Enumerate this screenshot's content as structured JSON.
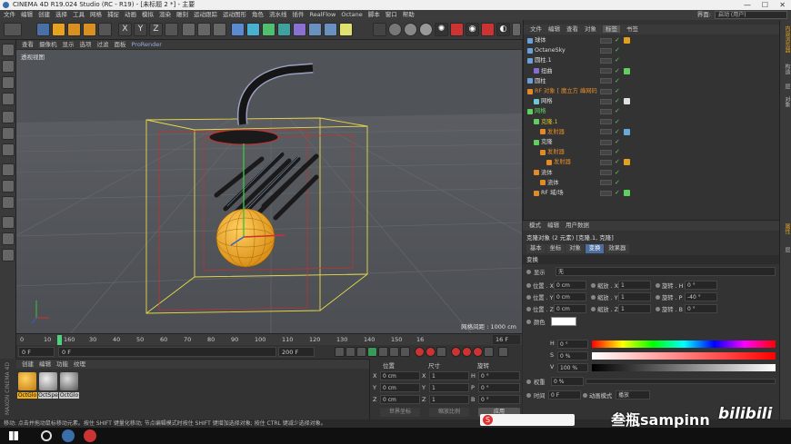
{
  "window": {
    "title": "CINEMA 4D R19.024 Studio (RC - R19) - [未标题 2 *] - 主要"
  },
  "menubar": {
    "items": [
      "文件",
      "编辑",
      "创建",
      "选择",
      "工具",
      "网格",
      "捕捉",
      "动画",
      "模拟",
      "渲染",
      "雕刻",
      "运动跟踪",
      "运动图形",
      "角色",
      "流水线",
      "插件",
      "RealFlow",
      "Octane",
      "脚本",
      "窗口",
      "帮助"
    ],
    "layout_label": "界面:",
    "layout_value": "启动 (用户)"
  },
  "viewport": {
    "menu": [
      "查看",
      "摄像机",
      "显示",
      "选项",
      "过滤",
      "面板",
      "ProRender"
    ],
    "label": "透视视图",
    "grid_spacing": "网格间距 : 1000 cm"
  },
  "timeline": {
    "ticks": [
      "0",
      "10",
      "160",
      "30",
      "40",
      "50",
      "60",
      "70",
      "80",
      "90",
      "100",
      "110",
      "120",
      "130",
      "140",
      "150",
      "16"
    ],
    "current_frame": "16 F",
    "start": "0 F",
    "start2": "0 F",
    "end": "200 F",
    "end2": "200 F"
  },
  "material_panel": {
    "menu": [
      "创建",
      "编辑",
      "功能",
      "纹理"
    ],
    "materials": [
      "OctGlo",
      "OctSpe",
      "OctGlo"
    ],
    "brand": "MAXON CINEMA 4D"
  },
  "coord_panel": {
    "headers": [
      "位置",
      "尺寸",
      "旋转"
    ],
    "rows": [
      {
        "axis": "X",
        "pos": "0 cm",
        "size_axis": "X",
        "size": "1",
        "rot_axis": "H",
        "rot": "0 °"
      },
      {
        "axis": "Y",
        "pos": "0 cm",
        "size_axis": "Y",
        "size": "1",
        "rot_axis": "P",
        "rot": "0 °"
      },
      {
        "axis": "Z",
        "pos": "0 cm",
        "size_axis": "Z",
        "size": "1",
        "rot_axis": "B",
        "rot": "0 °"
      }
    ],
    "mode1": "世界坐标",
    "mode2": "缩放比例",
    "apply": "应用"
  },
  "object_panel": {
    "menu": [
      "文件",
      "编辑",
      "查看",
      "对象",
      "标签",
      "书签"
    ],
    "active_menu": "标签",
    "objects": [
      {
        "name": "球体",
        "indent": 0,
        "color": "#dcdcdc",
        "icon": "#6a9fd8"
      },
      {
        "name": "OctaneSky",
        "indent": 0,
        "color": "#dcdcdc",
        "icon": "#6a9fd8"
      },
      {
        "name": "圆柱.1",
        "indent": 0,
        "color": "#dcdcdc",
        "icon": "#6a9fd8"
      },
      {
        "name": "扭曲",
        "indent": 1,
        "color": "#dcdcdc",
        "icon": "#8a6ad8"
      },
      {
        "name": "圆柱",
        "indent": 0,
        "color": "#dcdcdc",
        "icon": "#6a9fd8"
      },
      {
        "name": "RF 对象 [ 魔立方 峰网码",
        "indent": 0,
        "color": "#e08a2a",
        "icon": "#e08a2a"
      },
      {
        "name": "网格",
        "indent": 1,
        "color": "#dcdcdc",
        "icon": "#6ac8d8"
      },
      {
        "name": "网格",
        "indent": 0,
        "color": "#5fd05f",
        "icon": "#5fd05f"
      },
      {
        "name": "克隆.1",
        "indent": 1,
        "color": "#e0c030",
        "icon": "#5fd05f"
      },
      {
        "name": "发射器",
        "indent": 2,
        "color": "#e08a2a",
        "icon": "#e08a2a"
      },
      {
        "name": "克隆",
        "indent": 1,
        "color": "#dcdcdc",
        "icon": "#5fd05f"
      },
      {
        "name": "发射器",
        "indent": 2,
        "color": "#e08a2a",
        "icon": "#e08a2a"
      },
      {
        "name": "发射器",
        "indent": 3,
        "color": "#e08a2a",
        "icon": "#e08a2a"
      },
      {
        "name": "流体",
        "indent": 1,
        "color": "#dcdcdc",
        "icon": "#e08a2a"
      },
      {
        "name": "流体",
        "indent": 2,
        "color": "#dcdcdc",
        "icon": "#e08a2a"
      },
      {
        "name": "RF 域/场",
        "indent": 1,
        "color": "#dcdcdc",
        "icon": "#e08a2a"
      }
    ]
  },
  "attr_panel": {
    "menu": [
      "模式",
      "编辑",
      "用户数据"
    ],
    "title": "克隆对象 (2 元素) [克隆.1, 克隆]",
    "tabs": [
      "基本",
      "坐标",
      "对象",
      "变换",
      "效果器"
    ],
    "active_tab": "变换",
    "section": "变换",
    "display_label": "显示",
    "display_value": "无",
    "pos": [
      {
        "l": "位置 . X",
        "v": "0 cm"
      },
      {
        "l": "位置 . Y",
        "v": "0 cm"
      },
      {
        "l": "位置 . Z",
        "v": "0 cm"
      }
    ],
    "scale": [
      {
        "l": "缩放 . X",
        "v": "1"
      },
      {
        "l": "缩放 . Y",
        "v": "1"
      },
      {
        "l": "缩放 . Z",
        "v": "1"
      }
    ],
    "rot": [
      {
        "l": "旋转 . H",
        "v": "0 °"
      },
      {
        "l": "旋转 . P",
        "v": "-40 °"
      },
      {
        "l": "旋转 . B",
        "v": "0 °"
      }
    ],
    "color_label": "颜色",
    "h_label": "H",
    "h_val": "0 °",
    "s_label": "S",
    "s_val": "0 %",
    "v_label": "V",
    "v_val": "100 %",
    "weight_label": "权重",
    "weight_val": "0 %",
    "time_label": "时间",
    "time_val": "0 F",
    "anim_label": "动画模式",
    "anim_val": "播放"
  },
  "right_tabs": [
    "内容浏览器",
    "构造",
    "层",
    "对象"
  ],
  "right_tabs2": [
    "属性",
    "层"
  ],
  "statusbar": {
    "text": "移动: 点击并拖动鼠标移动元素。按住 SHIFT 键量化移动; 节点编辑模式时按住 SHIFT 键增加选择对象; 按住 CTRL 键减少选择对象。"
  },
  "watermark": {
    "text": "叁瓶sampinn",
    "logo": "bilibili"
  },
  "colors": {
    "accent": "#4c6fa0",
    "selection_yellow": "#e8d84a",
    "clone_green": "#5fd05f"
  }
}
